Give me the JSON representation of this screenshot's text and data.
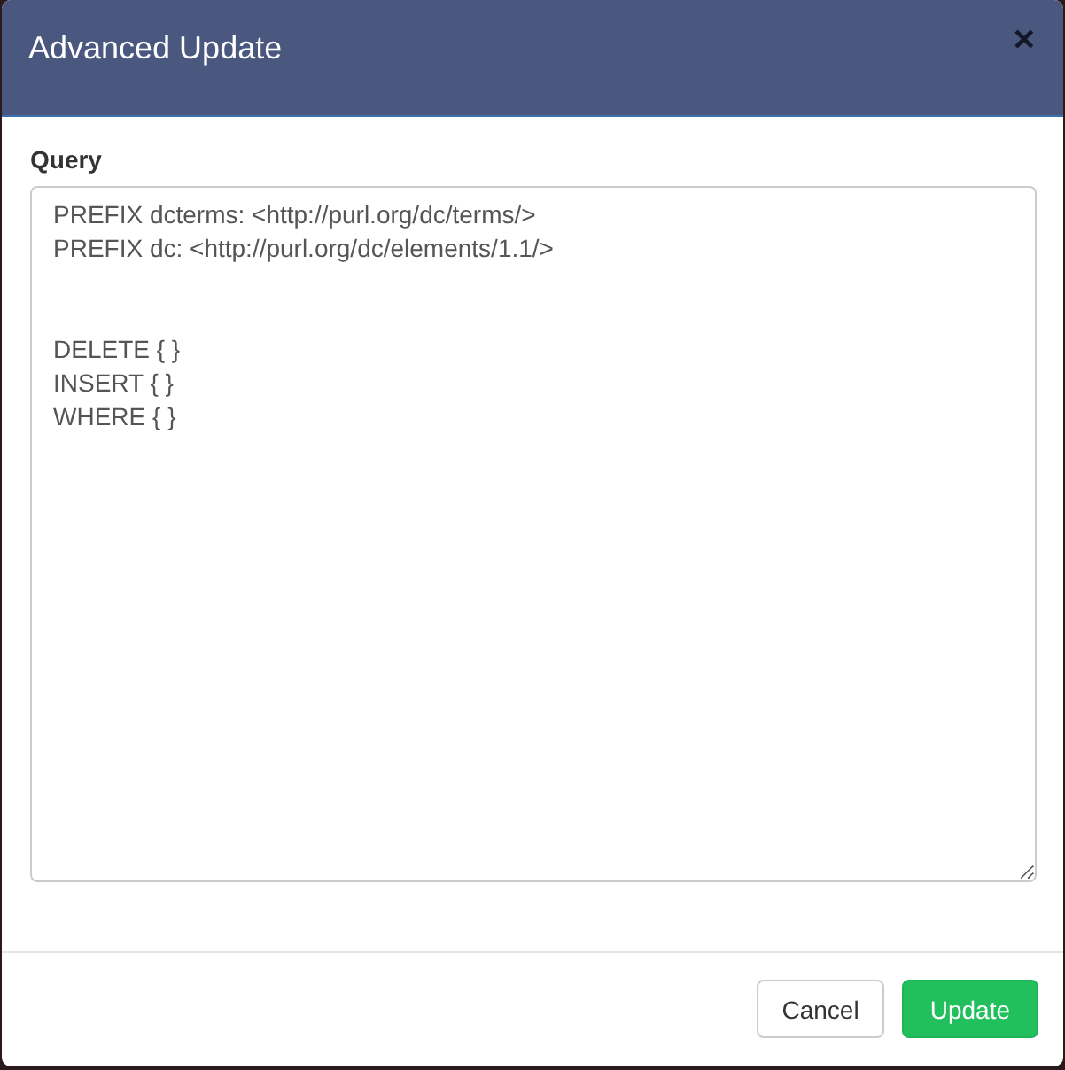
{
  "dialog": {
    "title": "Advanced Update",
    "close": "×"
  },
  "query": {
    "label": "Query",
    "value": "PREFIX dcterms: <http://purl.org/dc/terms/>\nPREFIX dc: <http://purl.org/dc/elements/1.1/>\n\n\nDELETE { }\nINSERT { }\nWHERE { }"
  },
  "buttons": [
    {
      "label": "Cancel",
      "kind": "default"
    },
    {
      "label": "Update",
      "kind": "primary"
    }
  ]
}
